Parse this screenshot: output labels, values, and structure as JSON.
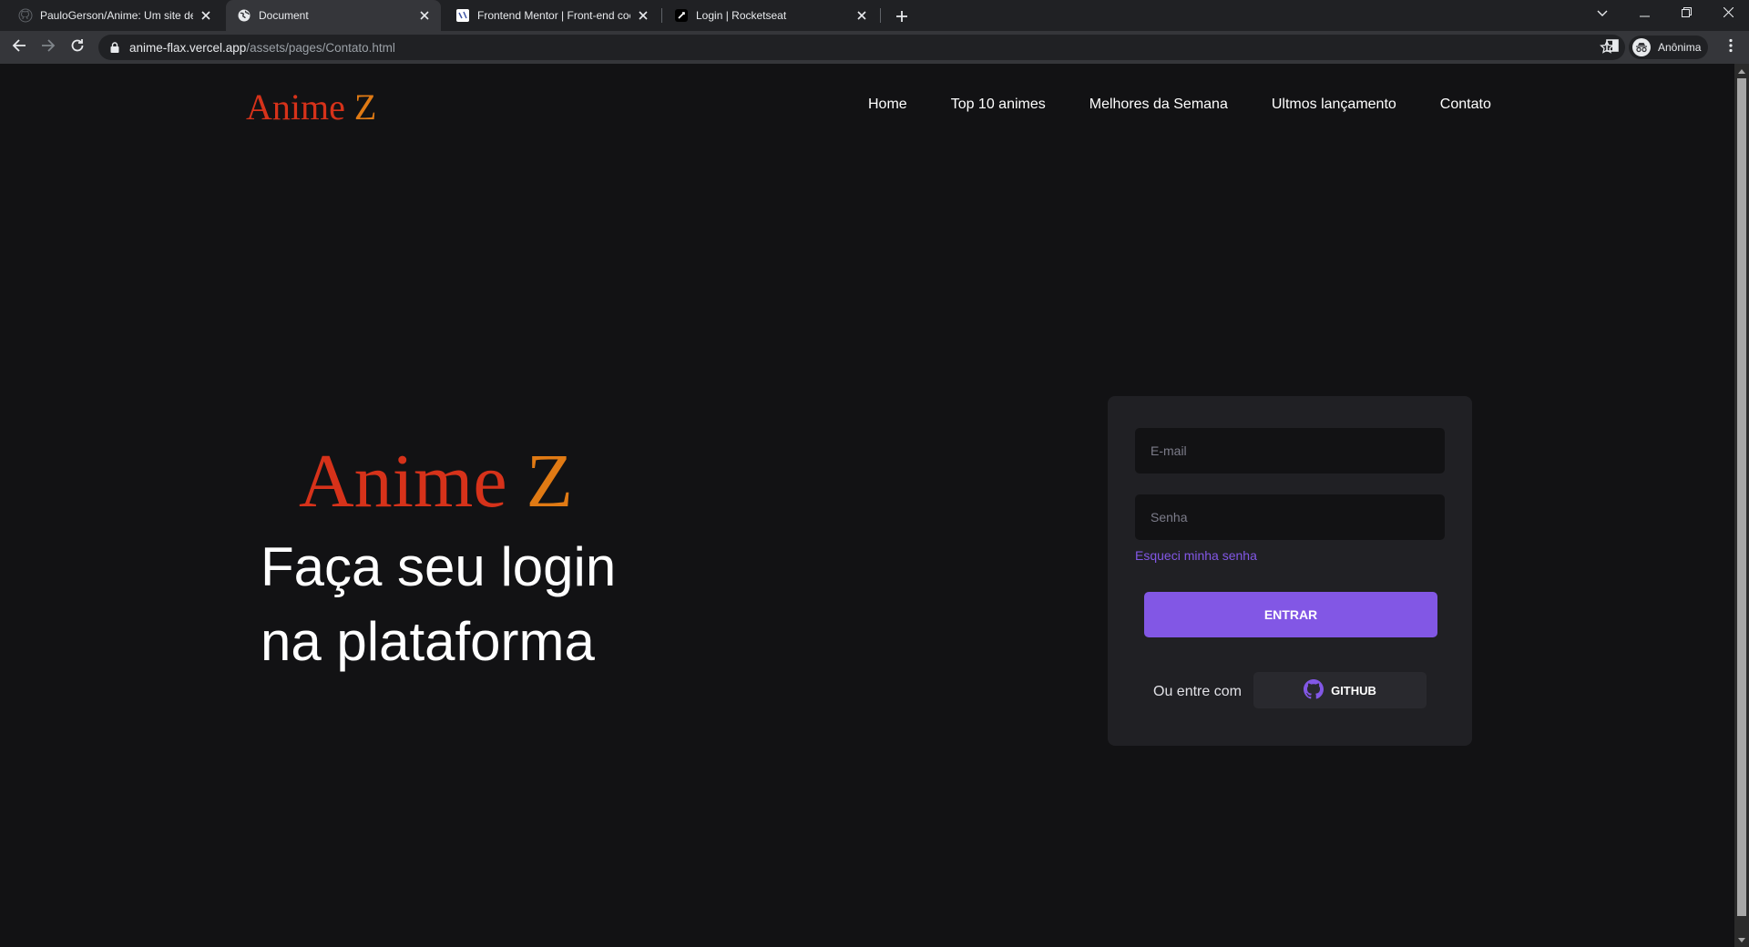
{
  "browser": {
    "tabs": [
      {
        "title": "PauloGerson/Anime: Um site de a",
        "favicon": "github-icon",
        "active": false
      },
      {
        "title": "Document",
        "favicon": "globe-icon",
        "active": true
      },
      {
        "title": "Frontend Mentor | Front-end coc",
        "favicon": "frontend-mentor-icon",
        "active": false
      },
      {
        "title": "Login | Rocketseat",
        "favicon": "rocketseat-icon",
        "active": false
      }
    ],
    "url": {
      "domain": "anime-flax.vercel.app",
      "path": "/assets/pages/Contato.html"
    },
    "profile_label": "Anônima"
  },
  "header": {
    "logo": {
      "main": "Anime ",
      "accent": "Z"
    },
    "nav": [
      "Home",
      "Top 10 animes",
      "Melhores da Semana",
      "Ultmos lançamento",
      "Contato"
    ]
  },
  "hero": {
    "logo": {
      "main": "Anime ",
      "accent": "Z"
    },
    "title_line1": "Faça seu login",
    "title_line2": "na plataforma"
  },
  "login": {
    "email_placeholder": "E-mail",
    "password_placeholder": "Senha",
    "forgot_label": "Esqueci minha senha",
    "submit_label": "ENTRAR",
    "alt_label": "Ou entre com",
    "github_label": "GITHUB"
  },
  "colors": {
    "background": "#121214",
    "card": "#202024",
    "accent_purple": "#8257e5",
    "logo_red": "#d6321a",
    "logo_orange": "#e07a14"
  }
}
